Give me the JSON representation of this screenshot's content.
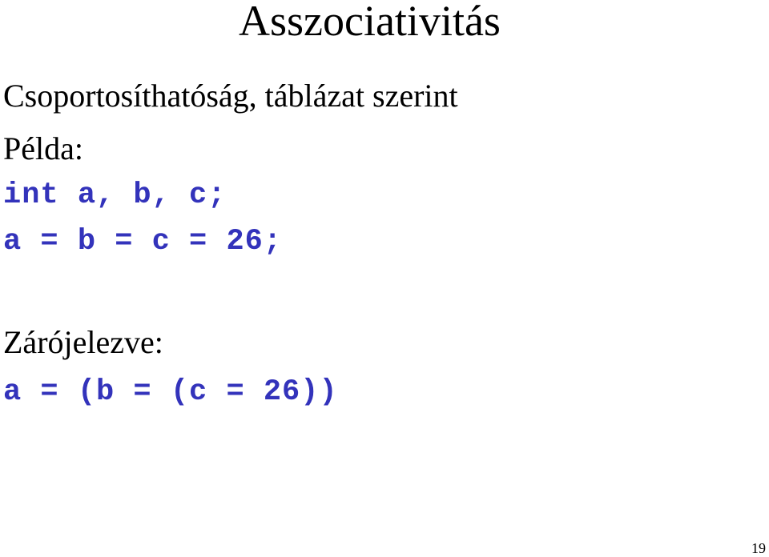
{
  "slide": {
    "title": "Asszociativitás",
    "subtitle": "Csoportosíthatóság, táblázat szerint",
    "example_label": "Példa:",
    "code_example": [
      "int a, b, c;",
      "a = b = c = 26;"
    ],
    "parenthesized_label": "Zárójelezve:",
    "code_parenthesized": "a = (b = (c = 26))",
    "page_number": "19"
  },
  "colors": {
    "text": "#000000",
    "code": "#3333bb",
    "background": "#ffffff"
  }
}
